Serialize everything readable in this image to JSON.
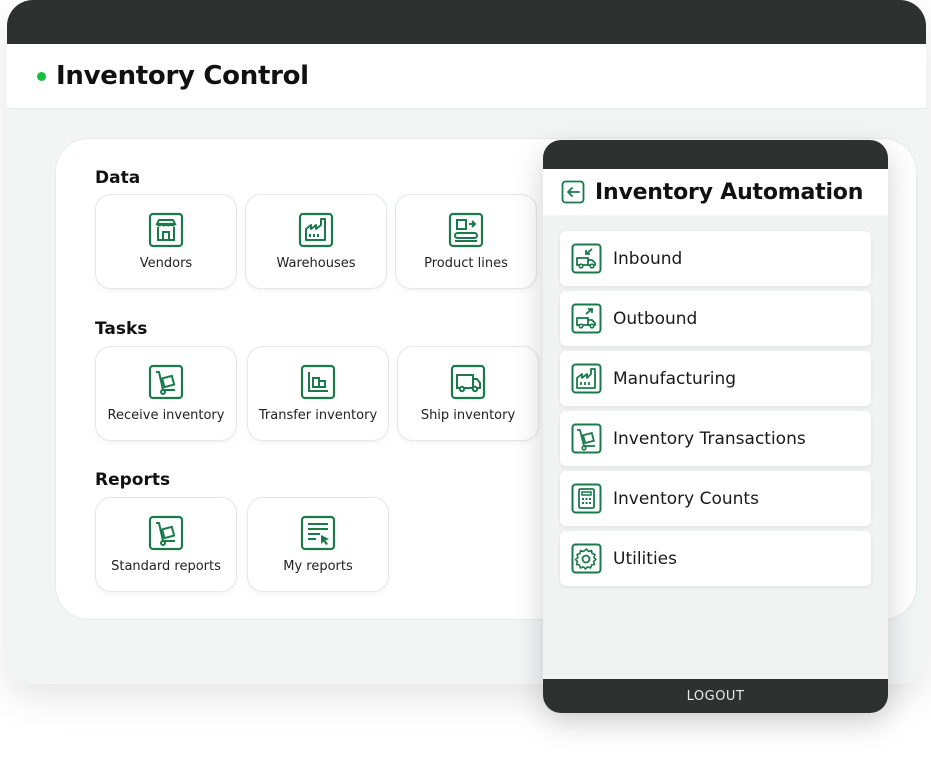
{
  "colors": {
    "accent": "#1a7a4c",
    "status_dot": "#16c23a",
    "dark_bar": "#2f3030"
  },
  "header": {
    "title": "Inventory Control"
  },
  "sections": {
    "data": {
      "label": "Data",
      "tiles": [
        {
          "label": "Vendors",
          "icon": "store-icon"
        },
        {
          "label": "Warehouses",
          "icon": "factory-icon"
        },
        {
          "label": "Product lines",
          "icon": "conveyor-icon"
        }
      ]
    },
    "tasks": {
      "label": "Tasks",
      "tiles": [
        {
          "label": "Receive inventory",
          "icon": "hand-truck-icon"
        },
        {
          "label": "Transfer inventory",
          "icon": "pallet-icon"
        },
        {
          "label": "Ship inventory",
          "icon": "truck-icon"
        }
      ]
    },
    "reports": {
      "label": "Reports",
      "tiles": [
        {
          "label": "Standard reports",
          "icon": "hand-truck-icon"
        },
        {
          "label": "My reports",
          "icon": "report-cursor-icon"
        }
      ]
    }
  },
  "mobile": {
    "title": "Inventory Automation",
    "menu": [
      {
        "label": "Inbound",
        "icon": "inbound-icon"
      },
      {
        "label": "Outbound",
        "icon": "outbound-icon"
      },
      {
        "label": "Manufacturing",
        "icon": "factory-icon"
      },
      {
        "label": "Inventory Transactions",
        "icon": "hand-truck-icon"
      },
      {
        "label": "Inventory Counts",
        "icon": "calculator-icon"
      },
      {
        "label": "Utilities",
        "icon": "gear-icon"
      }
    ],
    "logout_label": "LOGOUT"
  }
}
